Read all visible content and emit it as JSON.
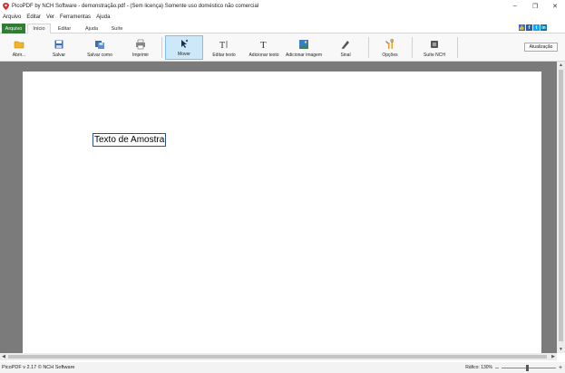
{
  "window": {
    "title": "PicoPDF by NCH Software - demonstração.pdf - (Sem licença) Somente uso doméstico não comercial",
    "minimize": "–",
    "maximize": "❐",
    "close": "✕"
  },
  "menu": [
    "Arquivo",
    "Editar",
    "Ver",
    "Ferramentas",
    "Ajuda"
  ],
  "tabs": {
    "arquivo": "Arquivo",
    "inicio": "Início",
    "editar": "Editar",
    "ajuda": "Ajuda",
    "suite": "Suíte"
  },
  "social": {
    "like": "👍",
    "facebook": "f",
    "twitter": "t",
    "linkedin": "in"
  },
  "toolbar": {
    "open": "Abrir...",
    "save": "Salvar",
    "save_as": "Salvar como",
    "print": "Imprimir",
    "move": "Mover",
    "edit_text": "Editar texto",
    "add_text": "Adicionar texto",
    "add_image": "Adicionar imagem",
    "sign": "Sinal",
    "options": "Opções",
    "nch_suite": "Suíte NCH",
    "update": "Atualização"
  },
  "document": {
    "sample_text": "Texto de Amostra"
  },
  "status": {
    "version": "PicoPDF v 2.17 © NCH Software",
    "zoom_label": "Ráfico: 130%",
    "zoom_out": "–",
    "zoom_in": "+"
  },
  "colors": {
    "arquivo_tab": "#2e7d32",
    "workspace": "#7b7b7b",
    "active_tool": "#cde8f8"
  }
}
